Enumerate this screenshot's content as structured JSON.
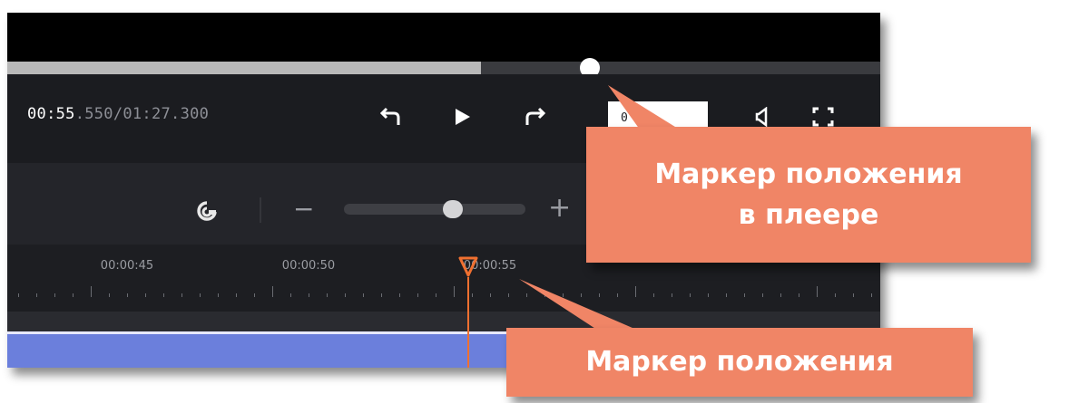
{
  "player": {
    "current_time": "00:55",
    "current_ms_and_total": ".550/01:27.300",
    "progress_fraction": 0.543,
    "snapshot_label": "0"
  },
  "controls": {
    "back_icon": "undo-arrow-icon",
    "play_icon": "play-icon",
    "forward_icon": "redo-arrow-icon",
    "volume_icon": "volume-icon",
    "fullscreen_icon": "fullscreen-icon"
  },
  "timeline": {
    "magnet_icon": "magnet-icon",
    "zoom_out": "−",
    "zoom_in": "+",
    "zoom_level_fraction": 0.6,
    "ticks": [
      "00:00:45",
      "00:00:50",
      "00:00:55"
    ]
  },
  "callouts": {
    "player_marker_line1": "Маркер положения",
    "player_marker_line2": "в плеере",
    "timeline_marker": "Маркер положения"
  },
  "colors": {
    "accent_playhead": "#f07030",
    "callout": "#f08566",
    "clip": "#6b7fdc"
  }
}
